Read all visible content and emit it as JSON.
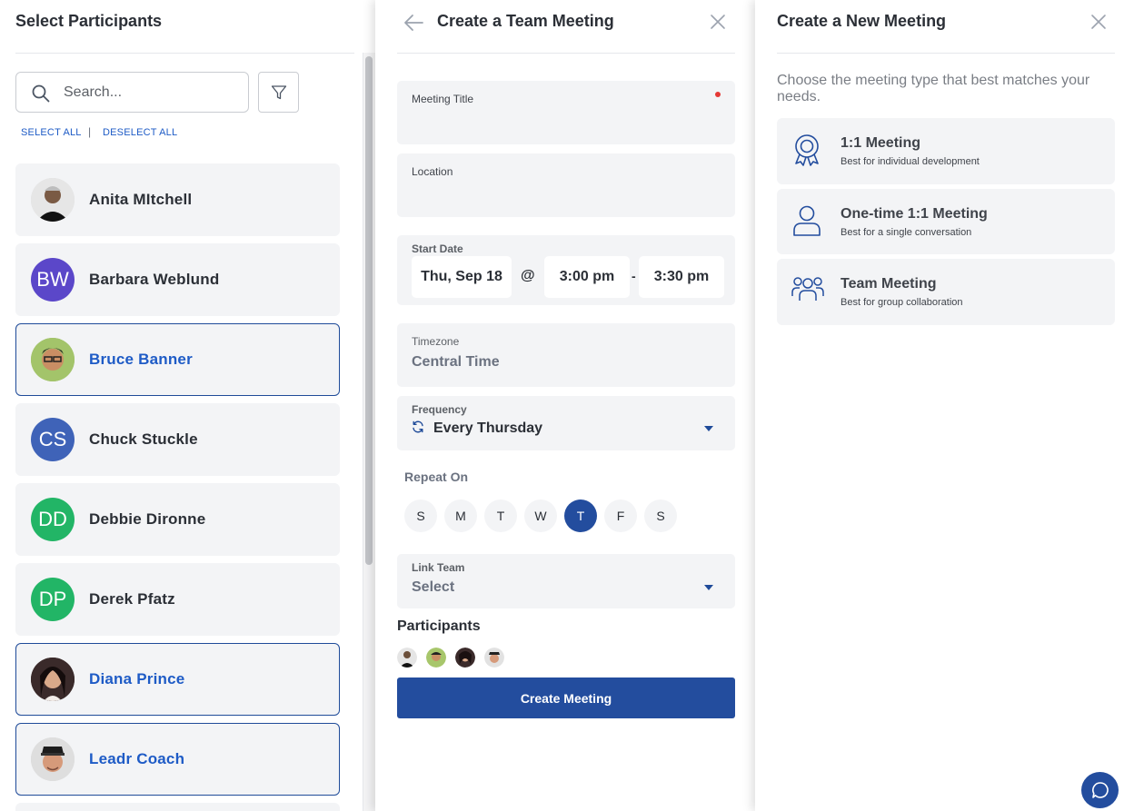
{
  "left_panel": {
    "title": "Select Participants",
    "search_placeholder": "Search...",
    "select_all": "SELECT ALL",
    "separator": "|",
    "deselect_all": "DESELECT ALL",
    "participants": [
      {
        "name": "Anita MItchell",
        "initials": "",
        "avatar_color": "#d9d9d9",
        "selected": false
      },
      {
        "name": "Barbara Weblund",
        "initials": "BW",
        "avatar_color": "#5b47c9",
        "selected": false
      },
      {
        "name": "Bruce Banner",
        "initials": "",
        "avatar_color": "#9bbd6a",
        "selected": true
      },
      {
        "name": "Chuck Stuckle",
        "initials": "CS",
        "avatar_color": "#3f63b8",
        "selected": false
      },
      {
        "name": "Debbie Dironne",
        "initials": "DD",
        "avatar_color": "#22b566",
        "selected": false
      },
      {
        "name": "Derek Pfatz",
        "initials": "DP",
        "avatar_color": "#22b566",
        "selected": false
      },
      {
        "name": "Diana Prince",
        "initials": "",
        "avatar_color": "#3a2a2a",
        "selected": true
      },
      {
        "name": "Leadr Coach",
        "initials": "",
        "avatar_color": "#d8d8d8",
        "selected": true
      }
    ]
  },
  "middle_panel": {
    "title": "Create a Team Meeting",
    "meeting_title_label": "Meeting Title",
    "location_label": "Location",
    "start_date_label": "Start Date",
    "start_date": "Thu, Sep 18",
    "at_symbol": "@",
    "start_time": "3:00 pm",
    "dash": "-",
    "end_time": "3:30 pm",
    "timezone_label": "Timezone",
    "timezone": "Central Time",
    "frequency_label": "Frequency",
    "frequency": "Every Thursday",
    "repeat_on_label": "Repeat On",
    "days": [
      {
        "label": "S",
        "active": false
      },
      {
        "label": "M",
        "active": false
      },
      {
        "label": "T",
        "active": false
      },
      {
        "label": "W",
        "active": false
      },
      {
        "label": "T",
        "active": true
      },
      {
        "label": "F",
        "active": false
      },
      {
        "label": "S",
        "active": false
      }
    ],
    "link_team_label": "Link Team",
    "link_team_value": "Select",
    "participants_label": "Participants",
    "create_button": "Create Meeting"
  },
  "right_panel": {
    "title": "Create a New Meeting",
    "description": "Choose the meeting type that best matches your needs.",
    "meeting_types": [
      {
        "name": "1:1 Meeting",
        "description": "Best for individual development",
        "icon": "award-ribbon-icon"
      },
      {
        "name": "One-time 1:1 Meeting",
        "description": "Best for a single conversation",
        "icon": "person-icon"
      },
      {
        "name": "Team Meeting",
        "description": "Best for group collaboration",
        "icon": "people-group-icon"
      }
    ]
  },
  "colors": {
    "primary": "#234d9e",
    "link": "#1e5bc6",
    "card_bg": "#f3f4f6",
    "required": "#e53935"
  }
}
